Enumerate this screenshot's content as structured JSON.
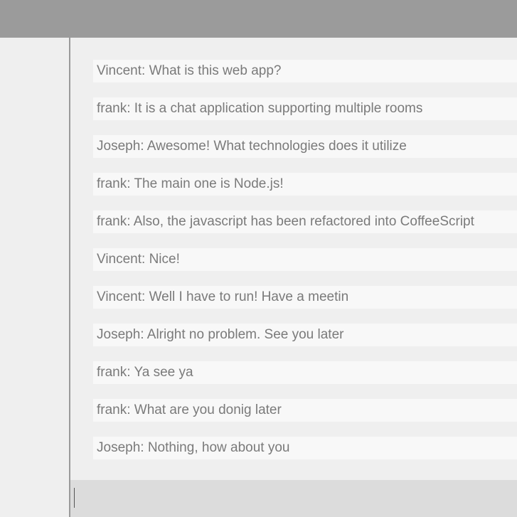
{
  "messages": [
    {
      "text": "Vincent: What is this web app?"
    },
    {
      "text": "frank: It is a chat application supporting multiple rooms"
    },
    {
      "text": "Joseph: Awesome! What technologies does it utilize"
    },
    {
      "text": "frank: The main one is Node.js!"
    },
    {
      "text": "frank: Also, the javascript has been refactored into CoffeeScript"
    },
    {
      "text": "Vincent: Nice!"
    },
    {
      "text": "Vincent: Well I have to run! Have a meetin"
    },
    {
      "text": "Joseph: Alright no problem. See you later"
    },
    {
      "text": "frank: Ya see ya"
    },
    {
      "text": "frank: What are you donig later"
    },
    {
      "text": "Joseph: Nothing, how about you"
    }
  ],
  "composer": {
    "value": "",
    "placeholder": ""
  },
  "colors": {
    "topbar": "#9b9b9b",
    "background": "#efefef",
    "message_bg": "#f8f8f8",
    "message_text": "#7a7a7a",
    "composer_bg": "#dcdcdc",
    "divider": "#9a9a9a"
  }
}
